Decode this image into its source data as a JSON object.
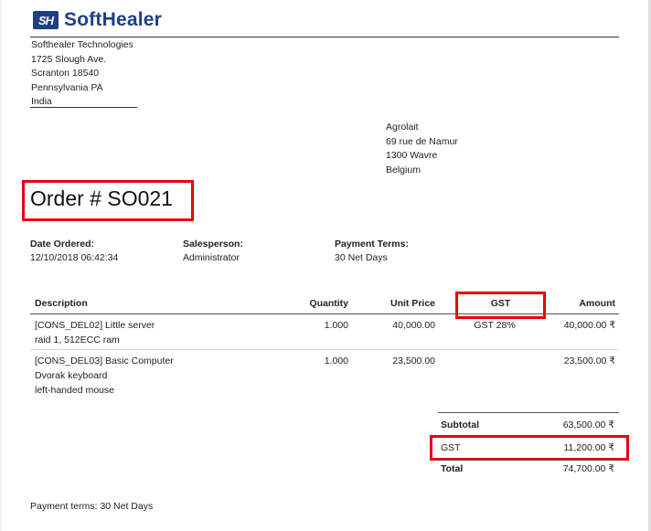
{
  "logo": {
    "mark": "SH",
    "text": "SoftHealer"
  },
  "company": {
    "name": "Softhealer Technologies",
    "street": "1725 Slough Ave.",
    "city": "Scranton 18540",
    "state": "Pennsylvania PA",
    "country": "India"
  },
  "partner": {
    "name": "Agrolait",
    "street": "69 rue de Namur",
    "city": "1300 Wavre",
    "country": "Belgium"
  },
  "order": {
    "title": "Order # SO021"
  },
  "info": {
    "date_label": "Date Ordered:",
    "date_value": "12/10/2018 06:42:34",
    "salesperson_label": "Salesperson:",
    "salesperson_value": "Administrator",
    "terms_label": "Payment Terms:",
    "terms_value": "30 Net Days"
  },
  "table": {
    "headers": {
      "description": "Description",
      "quantity": "Quantity",
      "unit_price": "Unit Price",
      "gst": "GST",
      "amount": "Amount"
    },
    "rows": [
      {
        "desc1": "[CONS_DEL02] Little server",
        "desc2": "raid 1, 512ECC ram",
        "desc3": "",
        "quantity": "1.000",
        "unit_price": "40,000.00",
        "gst": "GST 28%",
        "amount": "40,000.00 ₹"
      },
      {
        "desc1": "[CONS_DEL03] Basic Computer",
        "desc2": "Dvorak keyboard",
        "desc3": "left-handed mouse",
        "quantity": "1.000",
        "unit_price": "23,500.00",
        "gst": "",
        "amount": "23,500.00 ₹"
      }
    ]
  },
  "totals": {
    "subtotal_label": "Subtotal",
    "subtotal_value": "63,500.00 ₹",
    "gst_label": "GST",
    "gst_value": "11,200.00 ₹",
    "total_label": "Total",
    "total_value": "74,700.00 ₹"
  },
  "footer": {
    "note": "Payment terms: 30 Net Days"
  },
  "colors": {
    "brand": "#1f3f86",
    "highlight": "#e8000b"
  }
}
